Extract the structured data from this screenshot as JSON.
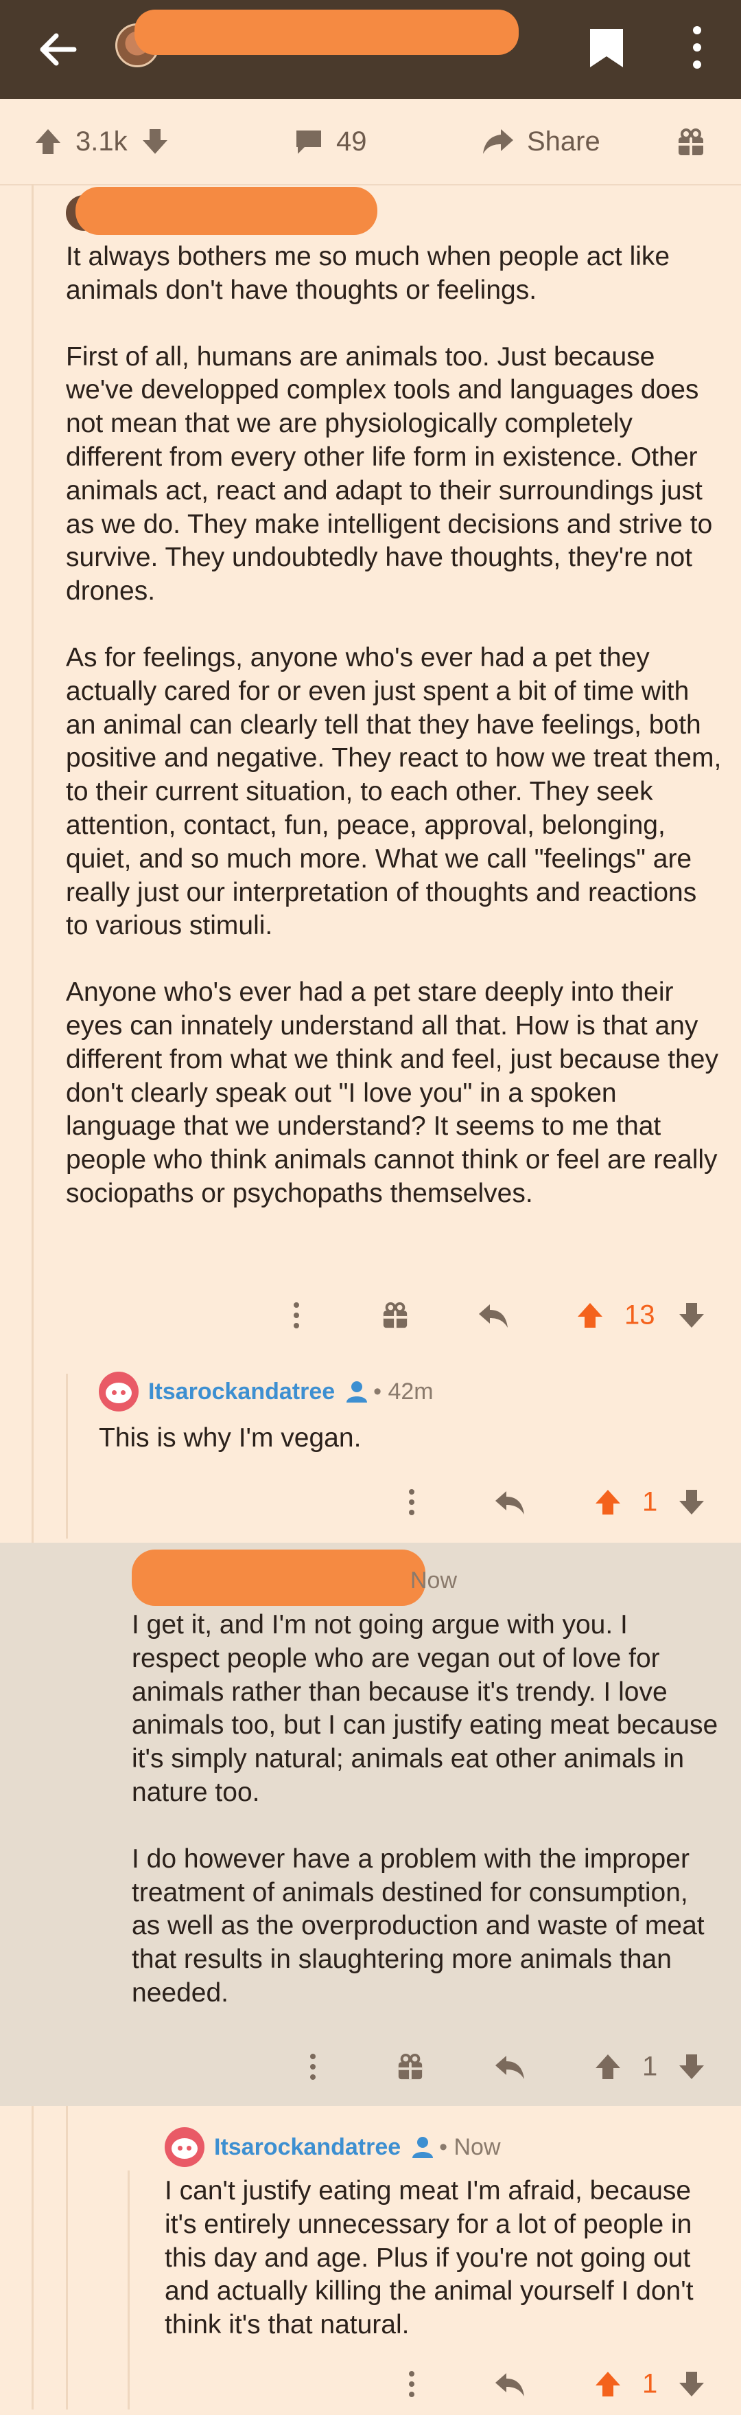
{
  "header": {
    "back_icon": "back-arrow-icon",
    "bookmark_icon": "bookmark-icon",
    "menu_icon": "more-vertical-icon"
  },
  "post_actions": {
    "upvotes": "3.1k",
    "comments": "49",
    "share_label": "Share"
  },
  "comments": [
    {
      "paragraphs": [
        "It always bothers me so much when people act like animals don't have thoughts or feelings.",
        "First of all, humans are animals too. Just because we've developped complex tools and languages does not mean that we are physiologically completely different from every other life form in existence. Other animals act, react and adapt to their surroundings just as we do. They make intelligent decisions and strive to survive. They undoubtedly have thoughts, they're not drones.",
        "As for feelings, anyone who's ever had a pet they actually cared for or even just spent a bit of time with an animal can clearly tell that they have feelings, both positive and negative. They react to how we treat them, to their current situation, to each other. They seek attention, contact, fun, peace, approval, belonging, quiet, and so much more. What we call \"feelings\" are really just our interpretation of thoughts and reactions to various stimuli.",
        "Anyone who's ever had a pet stare deeply into their eyes can innately understand all that. How is that any different from what we think and feel, just because they don't clearly speak out \"I love you\" in a spoken language that we understand? It seems to me that people who think animals cannot think or feel are really sociopaths or psychopaths themselves."
      ],
      "score": "13"
    },
    {
      "username": "Itsarockandatree",
      "time": "• 42m",
      "paragraphs": [
        "This is why I'm vegan."
      ],
      "score": "1"
    },
    {
      "time": "Now",
      "paragraphs": [
        "I get it, and I'm not going argue with you. I respect people who are vegan out of love for animals rather than because it's trendy. I love animals too, but I can justify eating meat because it's simply natural; animals eat other animals in nature too.",
        "I do however have a problem with the improper treatment of animals destined for consumption, as well as the overproduction and waste of meat that results in slaughtering more animals than needed."
      ],
      "score": "1"
    },
    {
      "username": "Itsarockandatree",
      "time": "• Now",
      "paragraphs": [
        "I can't justify eating meat I'm afraid, because it's entirely unnecessary for a lot of people in this day and age. Plus if you're not going out and actually killing the animal yourself I don't think it's that natural."
      ],
      "score": "1"
    }
  ],
  "colors": {
    "accent_upvote": "#f4621c",
    "username": "#3d8fd1",
    "background": "#fdebd9",
    "highlight": "#e6dccf"
  }
}
